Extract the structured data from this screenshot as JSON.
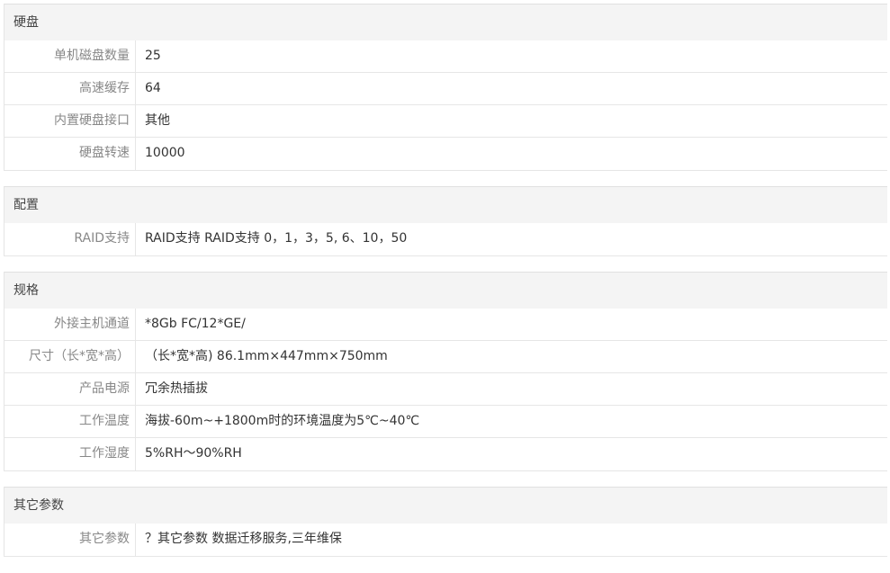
{
  "sections": [
    {
      "title": "硬盘",
      "rows": [
        {
          "label": "单机磁盘数量",
          "value": "25"
        },
        {
          "label": "高速缓存",
          "value": "64"
        },
        {
          "label": "内置硬盘接口",
          "value": "其他"
        },
        {
          "label": "硬盘转速",
          "value": "10000"
        }
      ]
    },
    {
      "title": "配置",
      "rows": [
        {
          "label": "RAID支持",
          "value": "RAID支持 RAID支持 0，1，3，5, 6、10，50"
        }
      ]
    },
    {
      "title": "规格",
      "rows": [
        {
          "label": "外接主机通道",
          "value": "*8Gb FC/12*GE/"
        },
        {
          "label": "尺寸（长*宽*高）",
          "value": "（长*宽*高) 86.1mm×447mm×750mm"
        },
        {
          "label": "产品电源",
          "value": "冗余热插拔"
        },
        {
          "label": "工作温度",
          "value": "海拔-60m~+1800m时的环境温度为5℃~40℃"
        },
        {
          "label": "工作湿度",
          "value": "5%RH～90%RH"
        }
      ]
    },
    {
      "title": "其它参数",
      "rows": [
        {
          "label": "其它参数",
          "value": "？其它参数 数据迁移服务,三年维保"
        }
      ]
    }
  ]
}
